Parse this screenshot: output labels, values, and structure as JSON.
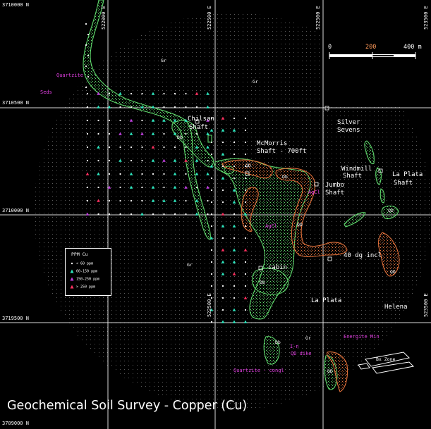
{
  "title": "Geochemical Soil Survey - Copper (Cu)",
  "grid": {
    "northings": [
      "3710000 N",
      "3710500 N",
      "3710000 N",
      "3719500 N",
      "3709000 N"
    ],
    "eastings": [
      "522000 E",
      "522500 E",
      "522500 E",
      "523500 E"
    ],
    "bottom_eastings": [
      "522500 E",
      "523500 E"
    ]
  },
  "scale_bar": {
    "labels": [
      "0",
      "200",
      "400 m"
    ],
    "colors": [
      "#ffffff",
      "#ff9a5a",
      "#ffffff"
    ]
  },
  "place_names": [
    {
      "id": "chilsan",
      "text": "Chilsan"
    },
    {
      "id": "chilsan-shaft",
      "text": "Shaft"
    },
    {
      "id": "mcmorris",
      "text": "McMorris"
    },
    {
      "id": "mcmorris-shaft",
      "text": "Shaft - 700ft"
    },
    {
      "id": "silver",
      "text": "Silver"
    },
    {
      "id": "sevens",
      "text": "Sevens"
    },
    {
      "id": "windmill",
      "text": "Windmill"
    },
    {
      "id": "windmill-shaft",
      "text": "Shaft"
    },
    {
      "id": "jumbo",
      "text": "Jumbo"
    },
    {
      "id": "jumbo-shaft",
      "text": "Shaft"
    },
    {
      "id": "laplata-shaft1",
      "text": "La Plata"
    },
    {
      "id": "laplata-shaft2",
      "text": "Shaft"
    },
    {
      "id": "incl",
      "text": "40 dg incl"
    },
    {
      "id": "cabin",
      "text": "cabin"
    },
    {
      "id": "laplata",
      "text": "La Plata"
    },
    {
      "id": "helena",
      "text": "Helena"
    }
  ],
  "geology_labels": [
    {
      "id": "gr1",
      "text": "Gr"
    },
    {
      "id": "gr2",
      "text": "Gr"
    },
    {
      "id": "gr3",
      "text": "Gr"
    },
    {
      "id": "gr4",
      "text": "Gr"
    },
    {
      "id": "db1",
      "text": "Db"
    },
    {
      "id": "db2",
      "text": "Db"
    },
    {
      "id": "db3",
      "text": "Db"
    },
    {
      "id": "db4",
      "text": "Db"
    },
    {
      "id": "qd1",
      "text": "QD"
    },
    {
      "id": "qd2",
      "text": "QD"
    },
    {
      "id": "qd3",
      "text": "QD"
    },
    {
      "id": "qd4",
      "text": "QD"
    },
    {
      "id": "qd5",
      "text": "QD"
    }
  ],
  "unit_labels": [
    {
      "id": "quartzite",
      "text": "Quartzite"
    },
    {
      "id": "seds",
      "text": "Seds"
    },
    {
      "id": "agcl1",
      "text": "AgCl"
    },
    {
      "id": "agcl2",
      "text": "AgCl"
    },
    {
      "id": "energite",
      "text": "Energite Min"
    },
    {
      "id": "in",
      "text": "I-n"
    },
    {
      "id": "qddike",
      "text": "QD dike"
    },
    {
      "id": "quartzite-congl",
      "text": "Quartzite - congl"
    },
    {
      "id": "bxzone",
      "text": "Bx Zone"
    }
  ],
  "legend": {
    "title": "PPM   Cu",
    "classes": [
      {
        "label": "< 60 ppm",
        "color": "#ffffff",
        "symbol": "dot"
      },
      {
        "label": "60-150 ppm",
        "color": "#2ee8c0",
        "symbol": "triangle"
      },
      {
        "label": "150-250 ppm",
        "color": "#c040e0",
        "symbol": "triangle"
      },
      {
        "label": "> 250 ppm",
        "color": "#ff3060",
        "symbol": "triangle"
      }
    ]
  },
  "colors": {
    "outline": "#5ed66b",
    "stipple": "#5ed66b",
    "agcl_outline": "#e0703a",
    "grid": "#ffffff",
    "background": "#000000"
  }
}
